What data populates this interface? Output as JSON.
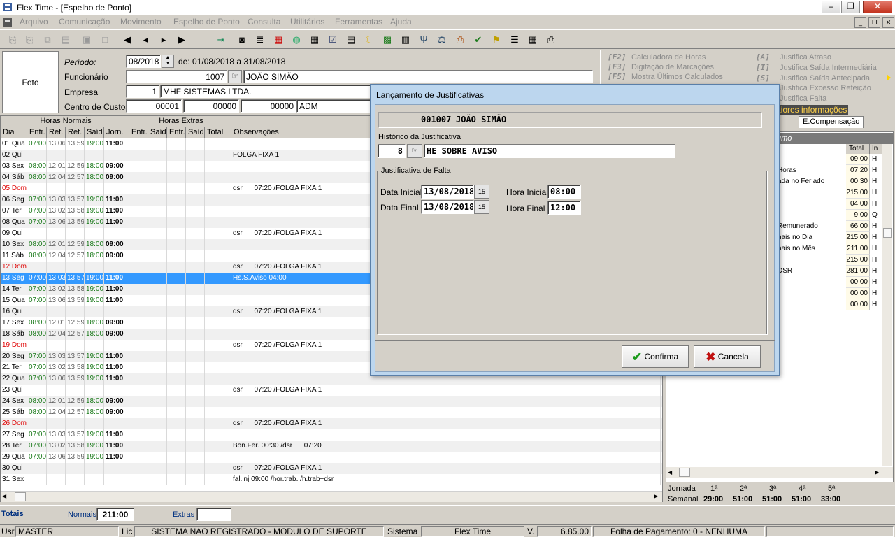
{
  "window": {
    "title": "Flex Time - [Espelho de Ponto]"
  },
  "menu": [
    "Arquivo",
    "Comunicação",
    "Movimento",
    "Espelho de Ponto",
    "Consulta",
    "Utilitários",
    "Ferramentas",
    "Ajuda"
  ],
  "toolbar_icons": [
    "new-icon",
    "copy-icon",
    "copy-icon",
    "print-preview-icon",
    "save-icon",
    "blank-icon",
    "first-icon",
    "prev-icon",
    "next-icon",
    "last-icon",
    "exit-icon",
    "employee-icon",
    "list-icon",
    "calculator-icon",
    "globe-icon",
    "grid-icon",
    "check-icon",
    "calendar-icon",
    "moon-icon",
    "excel-icon",
    "table-icon",
    "scale-icon",
    "fork-icon",
    "balance-icon",
    "document-icon",
    "checkmarks-icon",
    "list-icon",
    "calculator-icon",
    "printer-icon"
  ],
  "header": {
    "foto": "Foto",
    "periodo_label": "Período:",
    "periodo_value": "08/2018",
    "periodo_range": "de: 01/08/2018 a 31/08/2018",
    "funcionario_label": "Funcionário",
    "funcionario_code": "1007",
    "funcionario_name": "JOÃO SIMÃO",
    "empresa_label": "Empresa",
    "empresa_code": "1",
    "empresa_name": "MHF SISTEMAS LTDA.",
    "cc_label": "Centro de Custos",
    "cc1": "00001",
    "cc2": "00000",
    "cc3": "00000",
    "cc_name": "ADM"
  },
  "shortcuts_left": [
    {
      "key": "[F2]",
      "label": "Calculadora de Horas"
    },
    {
      "key": "[F3]",
      "label": "Digitação de Marcações"
    },
    {
      "key": "[F5]",
      "label": "Mostra Últimos Calculados"
    }
  ],
  "shortcuts_right": [
    {
      "key": "[A]",
      "label": "Justifica Atraso"
    },
    {
      "key": "[I]",
      "label": "Justifica Saída Intermediária"
    },
    {
      "key": "[S]",
      "label": "Justifica Saída Antecipada"
    },
    {
      "key": "",
      "label": "Justifica Excesso Refeição"
    },
    {
      "key": "",
      "label": "Justifica Falta"
    }
  ],
  "maiores": "aiores informações",
  "grid": {
    "group_normais": "Horas Normais",
    "group_extras": "Horas Extras",
    "columns": [
      "Dia",
      "Entr.",
      "Ref.",
      "Ret.",
      "Saída",
      "Jorn.",
      "Entr.",
      "Saída",
      "Entr.",
      "Saída",
      "Total",
      "Observações"
    ],
    "rows": [
      {
        "dia": "01 Qua",
        "e": "07:00",
        "ref": "13:06",
        "ret": "13:59",
        "s": "19:00",
        "j": "11:00",
        "obs": "",
        "color": "n"
      },
      {
        "dia": "02 Qui",
        "e": "",
        "ref": "",
        "ret": "",
        "s": "",
        "j": "",
        "obs": "FOLGA FIXA 1",
        "color": "n"
      },
      {
        "dia": "03 Sex",
        "e": "08:00",
        "ref": "12:01",
        "ret": "12:59",
        "s": "18:00",
        "j": "09:00",
        "obs": "",
        "color": "n"
      },
      {
        "dia": "04 Sáb",
        "e": "08:00",
        "ref": "12:04",
        "ret": "12:57",
        "s": "18:00",
        "j": "09:00",
        "obs": "",
        "color": "n"
      },
      {
        "dia": "05 Dom",
        "e": "",
        "ref": "",
        "ret": "",
        "s": "",
        "j": "",
        "obs": "dsr      07:20 /FOLGA FIXA 1",
        "color": "r"
      },
      {
        "dia": "06 Seg",
        "e": "07:00",
        "ref": "13:03",
        "ret": "13:57",
        "s": "19:00",
        "j": "11:00",
        "obs": "",
        "color": "n"
      },
      {
        "dia": "07 Ter",
        "e": "07:00",
        "ref": "13:02",
        "ret": "13:58",
        "s": "19:00",
        "j": "11:00",
        "obs": "",
        "color": "n"
      },
      {
        "dia": "08 Qua",
        "e": "07:00",
        "ref": "13:06",
        "ret": "13:59",
        "s": "19:00",
        "j": "11:00",
        "obs": "",
        "color": "n"
      },
      {
        "dia": "09 Qui",
        "e": "",
        "ref": "",
        "ret": "",
        "s": "",
        "j": "",
        "obs": "dsr      07:20 /FOLGA FIXA 1",
        "color": "n"
      },
      {
        "dia": "10 Sex",
        "e": "08:00",
        "ref": "12:01",
        "ret": "12:59",
        "s": "18:00",
        "j": "09:00",
        "obs": "",
        "color": "n"
      },
      {
        "dia": "11 Sáb",
        "e": "08:00",
        "ref": "12:04",
        "ret": "12:57",
        "s": "18:00",
        "j": "09:00",
        "obs": "",
        "color": "n"
      },
      {
        "dia": "12 Dom",
        "e": "",
        "ref": "",
        "ret": "",
        "s": "",
        "j": "",
        "obs": "dsr      07:20 /FOLGA FIXA 1",
        "color": "r"
      },
      {
        "dia": "13 Seg",
        "e": "07:00",
        "ref": "13:03",
        "ret": "13:57",
        "s": "19:00",
        "j": "11:00",
        "obs": "Hs.S.Aviso 04:00",
        "color": "s"
      },
      {
        "dia": "14 Ter",
        "e": "07:00",
        "ref": "13:02",
        "ret": "13:58",
        "s": "19:00",
        "j": "11:00",
        "obs": "",
        "color": "n"
      },
      {
        "dia": "15 Qua",
        "e": "07:00",
        "ref": "13:06",
        "ret": "13:59",
        "s": "19:00",
        "j": "11:00",
        "obs": "",
        "color": "n"
      },
      {
        "dia": "16 Qui",
        "e": "",
        "ref": "",
        "ret": "",
        "s": "",
        "j": "",
        "obs": "dsr      07:20 /FOLGA FIXA 1",
        "color": "n"
      },
      {
        "dia": "17 Sex",
        "e": "08:00",
        "ref": "12:01",
        "ret": "12:59",
        "s": "18:00",
        "j": "09:00",
        "obs": "",
        "color": "n"
      },
      {
        "dia": "18 Sáb",
        "e": "08:00",
        "ref": "12:04",
        "ret": "12:57",
        "s": "18:00",
        "j": "09:00",
        "obs": "",
        "color": "n"
      },
      {
        "dia": "19 Dom",
        "e": "",
        "ref": "",
        "ret": "",
        "s": "",
        "j": "",
        "obs": "dsr      07:20 /FOLGA FIXA 1",
        "color": "r"
      },
      {
        "dia": "20 Seg",
        "e": "07:00",
        "ref": "13:03",
        "ret": "13:57",
        "s": "19:00",
        "j": "11:00",
        "obs": "",
        "color": "n"
      },
      {
        "dia": "21 Ter",
        "e": "07:00",
        "ref": "13:02",
        "ret": "13:58",
        "s": "19:00",
        "j": "11:00",
        "obs": "",
        "color": "n"
      },
      {
        "dia": "22 Qua",
        "e": "07:00",
        "ref": "13:06",
        "ret": "13:59",
        "s": "19:00",
        "j": "11:00",
        "obs": "",
        "color": "n"
      },
      {
        "dia": "23 Qui",
        "e": "",
        "ref": "",
        "ret": "",
        "s": "",
        "j": "",
        "obs": "dsr      07:20 /FOLGA FIXA 1",
        "color": "n"
      },
      {
        "dia": "24 Sex",
        "e": "08:00",
        "ref": "12:01",
        "ret": "12:59",
        "s": "18:00",
        "j": "09:00",
        "obs": "",
        "color": "n"
      },
      {
        "dia": "25 Sáb",
        "e": "08:00",
        "ref": "12:04",
        "ret": "12:57",
        "s": "18:00",
        "j": "09:00",
        "obs": "",
        "color": "n"
      },
      {
        "dia": "26 Dom",
        "e": "",
        "ref": "",
        "ret": "",
        "s": "",
        "j": "",
        "obs": "dsr      07:20 /FOLGA FIXA 1",
        "color": "r"
      },
      {
        "dia": "27 Seg",
        "e": "07:00",
        "ref": "13:03",
        "ret": "13:57",
        "s": "19:00",
        "j": "11:00",
        "obs": "",
        "color": "n"
      },
      {
        "dia": "28 Ter",
        "e": "07:00",
        "ref": "13:02",
        "ret": "13:58",
        "s": "19:00",
        "j": "11:00",
        "obs": "Bon.Fer. 00:30 /dsr      07:20",
        "color": "n"
      },
      {
        "dia": "29 Qua",
        "e": "07:00",
        "ref": "13:06",
        "ret": "13:59",
        "s": "19:00",
        "j": "11:00",
        "obs": "",
        "color": "n"
      },
      {
        "dia": "30 Qui",
        "e": "",
        "ref": "",
        "ret": "",
        "s": "",
        "j": "",
        "obs": "dsr      07:20 /FOLGA FIXA 1",
        "color": "n"
      },
      {
        "dia": "31 Sex",
        "e": "",
        "ref": "",
        "ret": "",
        "s": "",
        "j": "",
        "obs": "fal.inj 09:00 /hor.trab. /h.trab+dsr",
        "color": "n"
      }
    ]
  },
  "right_panel": {
    "tab1": "lha",
    "tab2": "E.Compensação",
    "head": "umo",
    "col_total": "Total",
    "col_in": "In",
    "rows": [
      {
        "label": "",
        "total": "09:00",
        "in": "H"
      },
      {
        "label": "Horas",
        "total": "07:20",
        "in": "H"
      },
      {
        "label": "ada no Feriado",
        "total": "00:30",
        "in": "H"
      },
      {
        "label": "",
        "total": "215:00",
        "in": "H"
      },
      {
        "label": "",
        "total": "04:00",
        "in": "H"
      },
      {
        "label": "",
        "total": "9,00",
        "in": "Q"
      },
      {
        "label": "Remunerado",
        "total": "66:00",
        "in": "H"
      },
      {
        "label": "nais no Dia",
        "total": "215:00",
        "in": "H"
      },
      {
        "label": "nais no Mês",
        "total": "211:00",
        "in": "H"
      },
      {
        "label": "",
        "total": "215:00",
        "in": "H"
      },
      {
        "label": "DSR",
        "total": "281:00",
        "in": "H"
      },
      {
        "label": "",
        "total": "00:00",
        "in": "H"
      },
      {
        "label": "",
        "total": "00:00",
        "in": "H"
      },
      {
        "label": "",
        "total": "00:00",
        "in": "H"
      }
    ]
  },
  "jornada": {
    "label1": "Jornada",
    "label2": "Semanal",
    "weeks": [
      "1ª",
      "2ª",
      "3ª",
      "4ª",
      "5ª"
    ],
    "values": [
      "29:00",
      "51:00",
      "51:00",
      "51:00",
      "33:00"
    ]
  },
  "totals": {
    "label": "Totais",
    "normais_label": "Normais",
    "normais_value": "211:00",
    "extras_label": "Extras",
    "extras_value": ""
  },
  "status": {
    "usr_label": "Usr",
    "usr": "MASTER",
    "lic_label": "Lic",
    "lic": "SISTEMA NAO REGISTRADO - MODULO DE SUPORTE",
    "sistema_label": "Sistema",
    "sistema": "Flex Time",
    "v_label": "V.",
    "version": "6.85.00",
    "folha": "Folha de Pagamento: 0 - NENHUMA"
  },
  "dialog": {
    "title": "Lançamento de Justificativas",
    "emp_code": "001007",
    "emp_name": "JOÃO SIMÃO",
    "hist_label": "Histórico da Justificativa",
    "hist_code": "8",
    "hist_name": "HE SOBRE AVISO",
    "group_label": "Justificativa de Falta",
    "data_inicial_label": "Data Inicial",
    "data_inicial": "13/08/2018",
    "data_final_label": "Data Final",
    "data_final": "13/08/2018",
    "hora_inicial_label": "Hora Inicial",
    "hora_inicial": "08:00",
    "hora_final_label": "Hora Final",
    "hora_final": "12:00",
    "confirma": "Confirma",
    "cancela": "Cancela"
  },
  "colors": {
    "green": "#1a7a1a",
    "red": "#e00000",
    "selection": "#3399ff",
    "dialog_frame": "#bcd6ee"
  }
}
